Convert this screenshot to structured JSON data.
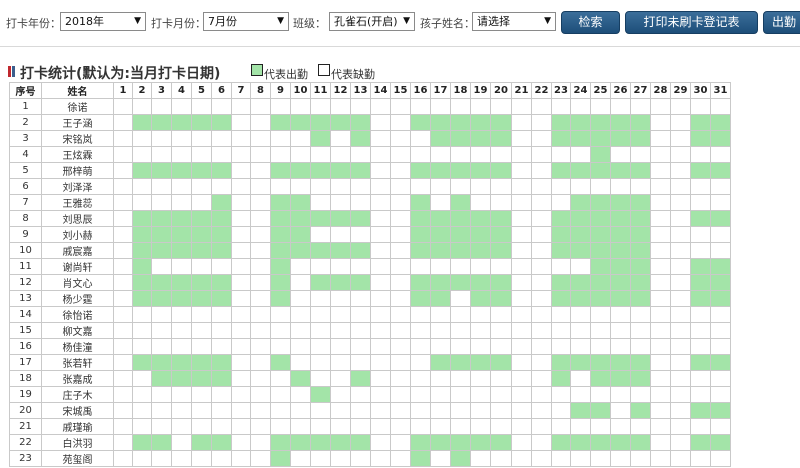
{
  "filters": {
    "year_label": "打卡年份：",
    "year_value": "2018年",
    "month_label": "打卡月份：",
    "month_value": "7月份",
    "class_label": "班级：",
    "class_value": "孔雀石(开启)",
    "child_label": "孩子姓名：",
    "child_value": "请选择",
    "search_button": "检索",
    "print_button": "打印未刷卡登记表",
    "export_button": "出勤"
  },
  "section": {
    "title": "打卡统计(默认为:当月打卡日期)",
    "legend_present": "代表出勤",
    "legend_absent": "代表缺勤"
  },
  "colors": {
    "present": "#a3e4a8",
    "button": "#1d4e79",
    "marker_red": "#c0282e",
    "marker_blue": "#3b5e8c"
  },
  "table": {
    "headers": [
      "序号",
      "姓名"
    ],
    "days": [
      "1",
      "2",
      "3",
      "4",
      "5",
      "6",
      "7",
      "8",
      "9",
      "10",
      "11",
      "12",
      "13",
      "14",
      "15",
      "16",
      "17",
      "18",
      "19",
      "20",
      "21",
      "22",
      "23",
      "24",
      "25",
      "26",
      "27",
      "28",
      "29",
      "30",
      "31"
    ],
    "rows": [
      {
        "idx": "1",
        "name": "徐诺",
        "present": []
      },
      {
        "idx": "2",
        "name": "王子涵",
        "present": [
          2,
          3,
          4,
          5,
          6,
          9,
          10,
          11,
          12,
          13,
          16,
          17,
          18,
          19,
          20,
          23,
          24,
          25,
          26,
          27,
          30,
          31
        ]
      },
      {
        "idx": "3",
        "name": "宋铭岚",
        "present": [
          11,
          13,
          17,
          18,
          19,
          20,
          23,
          24,
          25,
          26,
          27,
          30,
          31
        ]
      },
      {
        "idx": "4",
        "name": "王炫霖",
        "present": [
          25
        ]
      },
      {
        "idx": "5",
        "name": "邢梓萌",
        "present": [
          2,
          3,
          4,
          5,
          6,
          9,
          10,
          11,
          12,
          13,
          16,
          17,
          18,
          19,
          20,
          23,
          24,
          25,
          26,
          27,
          30,
          31
        ]
      },
      {
        "idx": "6",
        "name": "刘泽泽",
        "present": []
      },
      {
        "idx": "7",
        "name": "王雅蕊",
        "present": [
          6,
          9,
          10,
          16,
          18,
          24,
          25,
          26,
          27
        ]
      },
      {
        "idx": "8",
        "name": "刘思辰",
        "present": [
          2,
          3,
          4,
          5,
          6,
          9,
          10,
          11,
          12,
          13,
          16,
          17,
          18,
          19,
          20,
          23,
          24,
          25,
          26,
          27,
          30,
          31
        ]
      },
      {
        "idx": "9",
        "name": "刘小赫",
        "present": [
          2,
          3,
          4,
          5,
          6,
          9,
          10,
          16,
          17,
          18,
          19,
          20,
          23,
          24,
          25,
          26,
          27
        ]
      },
      {
        "idx": "10",
        "name": "戚宸嘉",
        "present": [
          2,
          3,
          4,
          5,
          6,
          9,
          10,
          11,
          12,
          13,
          16,
          17,
          18,
          19,
          20,
          23,
          24,
          25,
          26,
          27
        ]
      },
      {
        "idx": "11",
        "name": "谢尚轩",
        "present": [
          2,
          9,
          25,
          26,
          27,
          30,
          31
        ]
      },
      {
        "idx": "12",
        "name": "肖文心",
        "present": [
          2,
          3,
          4,
          5,
          6,
          9,
          11,
          12,
          13,
          16,
          17,
          18,
          19,
          20,
          23,
          24,
          25,
          26,
          27,
          30,
          31
        ]
      },
      {
        "idx": "13",
        "name": "杨少霆",
        "present": [
          2,
          3,
          4,
          5,
          6,
          9,
          16,
          17,
          19,
          20,
          23,
          24,
          25,
          26,
          27,
          30,
          31
        ]
      },
      {
        "idx": "14",
        "name": "徐怡诺",
        "present": []
      },
      {
        "idx": "15",
        "name": "柳文嘉",
        "present": []
      },
      {
        "idx": "16",
        "name": "杨佳潼",
        "present": []
      },
      {
        "idx": "17",
        "name": "张若轩",
        "present": [
          2,
          3,
          4,
          5,
          6,
          9,
          17,
          18,
          19,
          20,
          23,
          24,
          25,
          26,
          27,
          30,
          31
        ]
      },
      {
        "idx": "18",
        "name": "张嘉成",
        "present": [
          3,
          4,
          5,
          6,
          10,
          13,
          23,
          25,
          26,
          27
        ]
      },
      {
        "idx": "19",
        "name": "庄子木",
        "present": [
          11
        ]
      },
      {
        "idx": "20",
        "name": "宋城禹",
        "present": [
          24,
          25,
          27,
          30,
          31
        ]
      },
      {
        "idx": "21",
        "name": "戚瑾瑜",
        "present": []
      },
      {
        "idx": "22",
        "name": "白洪羽",
        "present": [
          2,
          3,
          5,
          6,
          9,
          10,
          11,
          12,
          13,
          16,
          17,
          18,
          19,
          20,
          23,
          24,
          25,
          26,
          27,
          30,
          31
        ]
      },
      {
        "idx": "23",
        "name": "苑玺阁",
        "present": [
          9,
          16,
          18
        ]
      }
    ]
  }
}
